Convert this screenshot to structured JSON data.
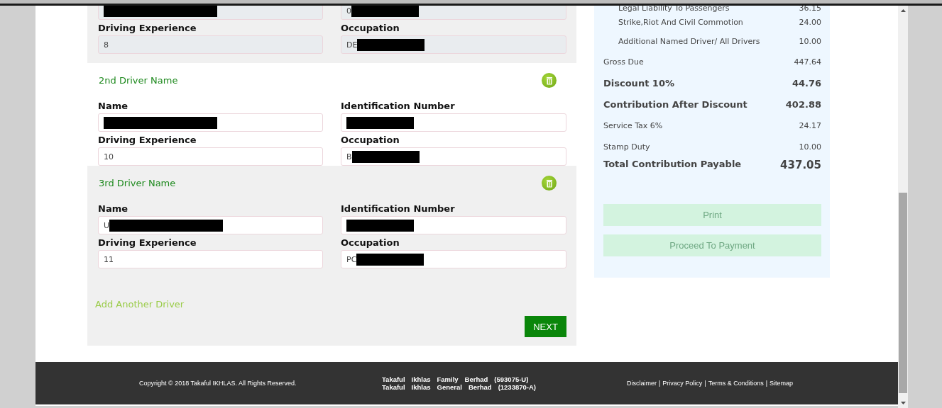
{
  "drivers": [
    {
      "disabled": true,
      "fields": [
        {
          "redacted": true
        },
        {
          "value": "0",
          "redacted": true
        },
        {
          "label": "Driving Experience",
          "value": "8"
        },
        {
          "label": "Occupation",
          "value": "DE",
          "redacted": true
        }
      ]
    },
    {
      "title": "2nd Driver Name",
      "disabled": false,
      "fields": [
        {
          "label": "Name",
          "redacted": true
        },
        {
          "label": "Identification Number",
          "redacted": true
        },
        {
          "label": "Driving Experience",
          "value": "10"
        },
        {
          "label": "Occupation",
          "value": "B",
          "redacted": true
        }
      ]
    },
    {
      "title": "3rd Driver Name",
      "disabled": false,
      "fields": [
        {
          "label": "Name",
          "value": "U",
          "redacted": true
        },
        {
          "label": "Identification Number",
          "redacted": true
        },
        {
          "label": "Driving Experience",
          "value": "11"
        },
        {
          "label": "Occupation",
          "value": "PC",
          "redacted": true
        }
      ]
    }
  ],
  "add_driver_link": "Add Another Driver",
  "next_button": "NEXT",
  "summary": {
    "rows": [
      {
        "kind": "cut",
        "label": "Legal Liability To Passengers",
        "value": "36.15"
      },
      {
        "kind": "sub",
        "label": "Strike,Riot And Civil Commotion",
        "value": "24.00"
      },
      {
        "kind": "sub",
        "label": "Additional Named Driver/ All Drivers",
        "value": "10.00"
      },
      {
        "kind": "normal",
        "label": "Gross Due",
        "value": "447.64"
      },
      {
        "kind": "bold",
        "label": "Discount 10%",
        "value": "44.76"
      },
      {
        "kind": "bold",
        "label": "Contribution After Discount",
        "value": "402.88"
      },
      {
        "kind": "normal",
        "label": "Service Tax 6%",
        "value": "24.17"
      },
      {
        "kind": "normal",
        "label": "Stamp Duty",
        "value": "10.00"
      },
      {
        "kind": "total",
        "label": "Total Contribution Payable",
        "value": "437.05"
      }
    ],
    "buttons": [
      {
        "label": "Print",
        "disabled": true
      },
      {
        "label": "Proceed To Payment",
        "disabled": true
      }
    ]
  },
  "footer": {
    "copyright": "Copyright © 2018 Takaful IKHLAS. All Rights Reserved.",
    "companies": [
      [
        "Takaful",
        "Ikhlas",
        "Family",
        "Berhad",
        "(593075-U)"
      ],
      [
        "Takaful",
        "Ikhlas",
        "General",
        "Berhad",
        "(1233870-A)"
      ]
    ],
    "links": [
      "Disclaimer",
      "Privacy Policy",
      "Terms & Conditions",
      "Sitemap"
    ],
    "separator": "|"
  }
}
